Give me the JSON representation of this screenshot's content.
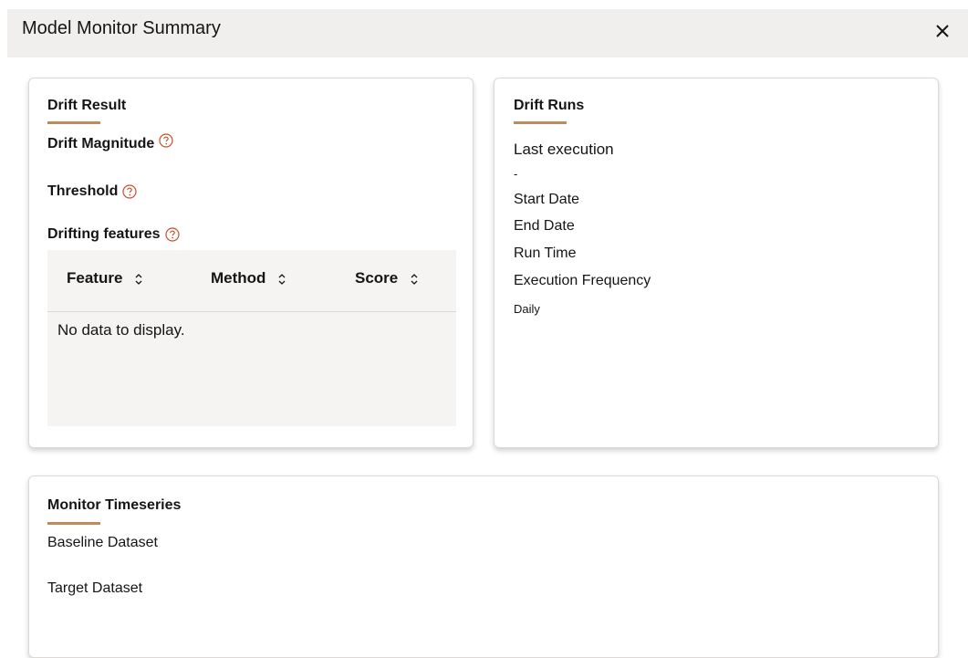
{
  "header": {
    "title": "Model Monitor Summary",
    "close_icon": "close-icon"
  },
  "drift_result": {
    "title": "Drift Result",
    "drift_magnitude_label": "Drift Magnitude",
    "threshold_label": "Threshold",
    "drifting_features_label": "Drifting features",
    "table": {
      "columns": [
        "Feature",
        "Method",
        "Score"
      ],
      "empty_message": "No data to display."
    }
  },
  "drift_runs": {
    "title": "Drift Runs",
    "last_execution_label": "Last execution",
    "last_execution_value": "-",
    "start_date_label": "Start Date",
    "end_date_label": "End Date",
    "run_time_label": "Run Time",
    "execution_frequency_label": "Execution Frequency",
    "execution_frequency_value": "Daily"
  },
  "monitor_timeseries": {
    "title": "Monitor Timeseries",
    "baseline_label": "Baseline Dataset",
    "target_label": "Target Dataset"
  },
  "colors": {
    "accent_underline": "#c08a5b",
    "help_icon": "#c8502b",
    "header_bg": "#f1efed"
  }
}
